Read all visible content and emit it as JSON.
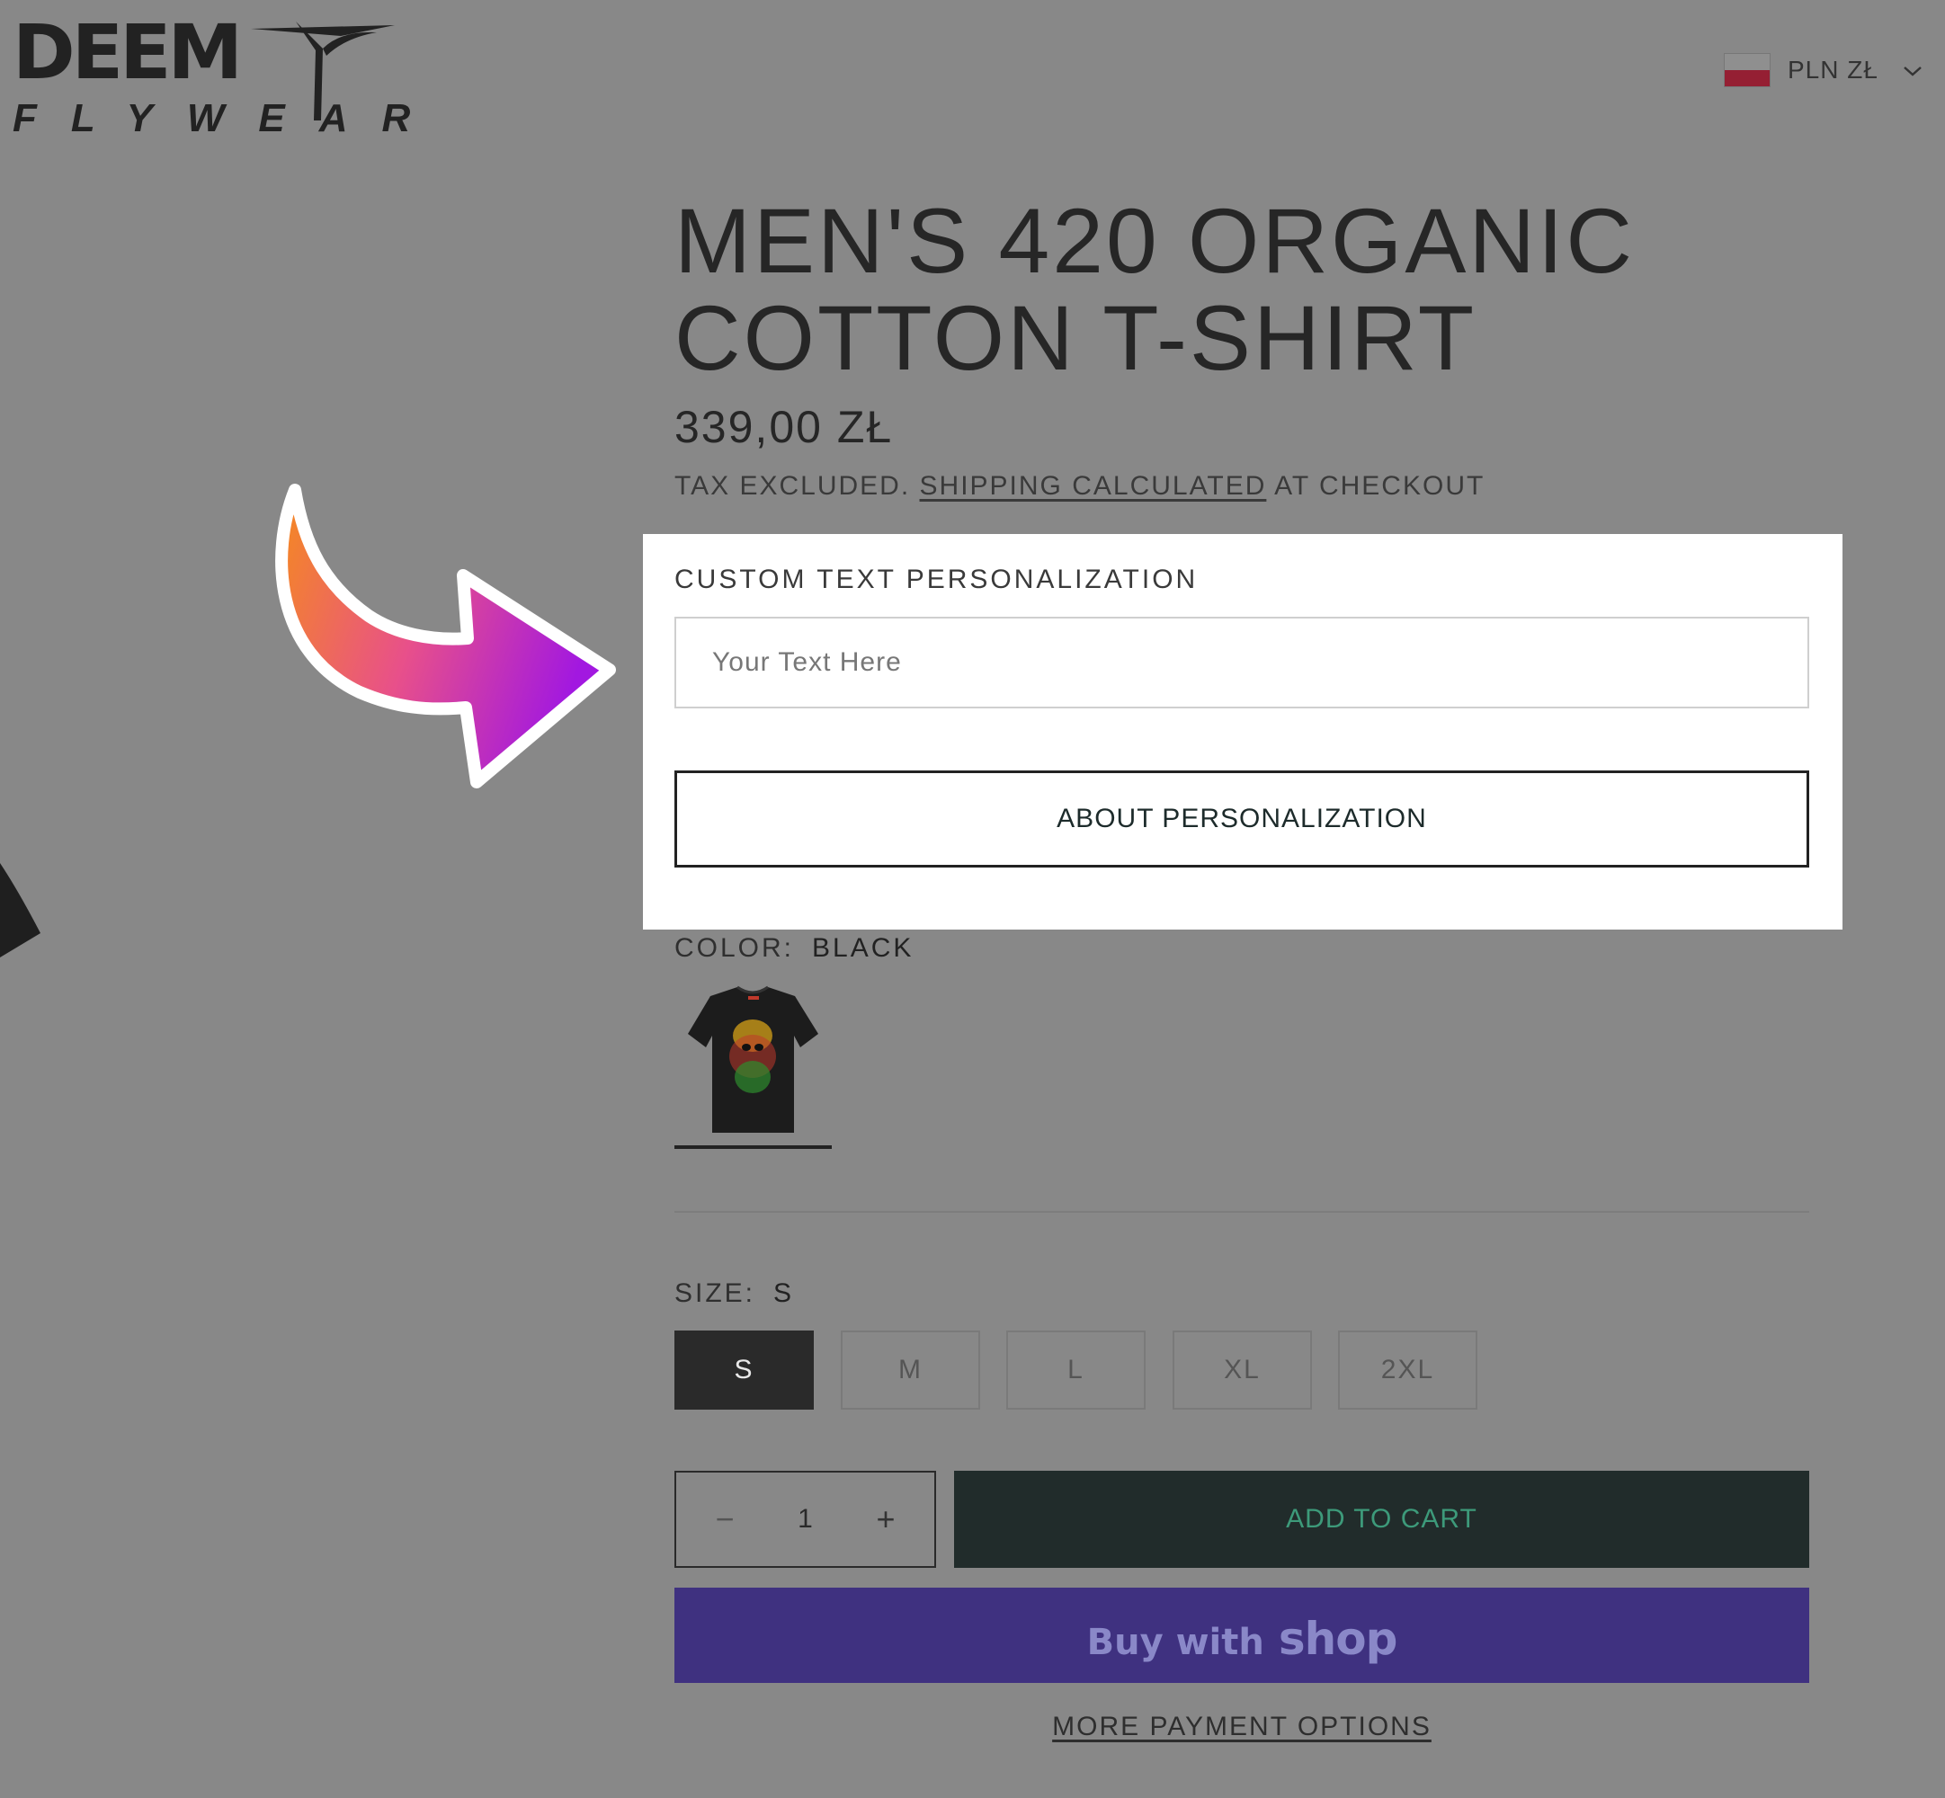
{
  "header": {
    "logo": {
      "wordmark": "DEEM",
      "subtitle": "FLYWEAR"
    },
    "currency": {
      "label": "PLN ZŁ",
      "flag_icon": "poland-flag-icon"
    }
  },
  "product": {
    "title": "MEN'S 420 ORGANIC COTTON T-SHIRT",
    "price": "339,00 ZŁ",
    "tax_note": {
      "prefix": "TAX EXCLUDED.",
      "link": "SHIPPING CALCULATED",
      "suffix": "AT CHECKOUT"
    }
  },
  "personalization": {
    "label": "CUSTOM TEXT PERSONALIZATION",
    "input_value": "",
    "input_placeholder": "Your Text Here",
    "about_button": "ABOUT PERSONALIZATION"
  },
  "color": {
    "label": "COLOR:",
    "value": "BLACK"
  },
  "size": {
    "label": "SIZE:",
    "value": "S",
    "options": [
      "S",
      "M",
      "L",
      "XL",
      "2XL"
    ],
    "selected": "S"
  },
  "purchase": {
    "quantity": "1",
    "minus": "−",
    "plus": "+",
    "add_to_cart": "ADD TO CART",
    "buy_with": "Buy with",
    "shop": "shop",
    "more_payment": "MORE PAYMENT OPTIONS"
  },
  "colors": {
    "background": "#888888",
    "panel": "#ffffff",
    "add_to_cart_bg": "#212c2b",
    "add_to_cart_text": "#3d9a7a",
    "shop_pay_bg": "#3f3180",
    "arrow_gradient": [
      "#f58a1f",
      "#e8508a",
      "#a218e0"
    ]
  }
}
